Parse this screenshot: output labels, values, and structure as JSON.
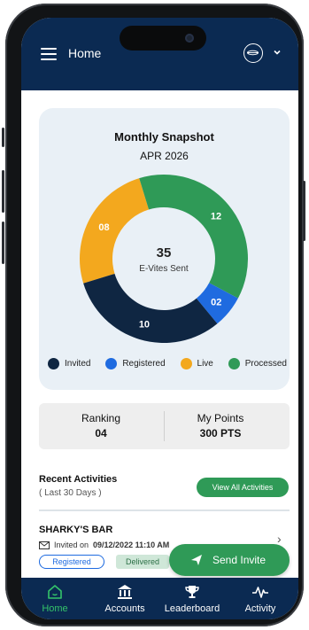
{
  "header": {
    "title": "Home"
  },
  "snapshot": {
    "title": "Monthly Snapshot",
    "period": "APR 2026",
    "center_value": "35",
    "center_label": "E-Vites Sent",
    "colors": {
      "invited": "#0f2642",
      "registered": "#1f6be0",
      "live": "#f3a81e",
      "processed": "#2f9a57"
    }
  },
  "chart_data": {
    "type": "pie",
    "title": "Monthly Snapshot",
    "subtitle": "APR 2026",
    "categories": [
      "Invited",
      "Registered",
      "Live",
      "Processed"
    ],
    "values": [
      10,
      2,
      8,
      12
    ],
    "labels": [
      "10",
      "02",
      "08",
      "12"
    ],
    "legend": "bottom"
  },
  "legend": [
    {
      "label": "Invited"
    },
    {
      "label": "Registered"
    },
    {
      "label": "Live"
    },
    {
      "label": "Processed"
    }
  ],
  "stats": {
    "ranking_label": "Ranking",
    "ranking_value": "04",
    "points_label": "My Points",
    "points_value": "300 PTS"
  },
  "recent": {
    "title": "Recent Activities",
    "subtitle": "( Last 30 Days )",
    "view_all": "View All Activities"
  },
  "activity": {
    "name": "SHARKY'S BAR",
    "invited_prefix": "Invited on",
    "invited_date": "09/12/2022  11:10 AM",
    "badge_registered": "Registered",
    "badge_delivered": "Delivered"
  },
  "send_invite": "Send Invite",
  "tabs": [
    {
      "label": "Home",
      "icon": "home-icon"
    },
    {
      "label": "Accounts",
      "icon": "bank-icon"
    },
    {
      "label": "Leaderboard",
      "icon": "trophy-icon"
    },
    {
      "label": "Activity",
      "icon": "pulse-icon"
    }
  ]
}
